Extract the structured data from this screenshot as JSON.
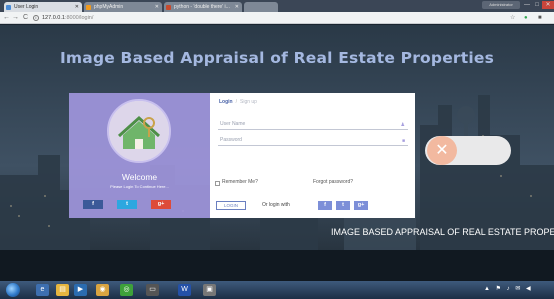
{
  "browser": {
    "tabs": [
      {
        "label": "User Login",
        "active": true
      },
      {
        "label": "phpMyAdmin",
        "active": false
      },
      {
        "label": "python - 'double there' i...",
        "active": false
      },
      {
        "label": "",
        "active": false
      }
    ],
    "url_host": "127.0.0.1",
    "url_path": ":8000/login/",
    "nav": {
      "back": "←",
      "forward": "→",
      "reload": "C"
    },
    "window": {
      "user_label": "Administrator",
      "minimize": "—",
      "maximize": "□",
      "close": "✕"
    },
    "extensions": {
      "bookmark": "☆",
      "ext1": "●",
      "ext2": "■"
    }
  },
  "page": {
    "title": "Image Based Appraisal of Real Estate Properties",
    "marquee": "IMAGE BASED APPRAISAL OF REAL ESTATE PROPERTIES"
  },
  "login_panel": {
    "welcome": "Welcome",
    "tagline": "Please Login To Continue Here...",
    "social": {
      "facebook": "f",
      "twitter": "t",
      "google": "g+"
    }
  },
  "login_form": {
    "tab_login": "Login",
    "tab_separator": "/",
    "tab_signup": "Sign up",
    "username_placeholder": "User Name",
    "password_placeholder": "Password",
    "remember_label": "Remember Me?",
    "forgot_label": "Forgot password?",
    "login_button": "LOGIN",
    "or_login_with": "Or login with",
    "social": {
      "facebook": "f",
      "twitter": "t",
      "google": "g+"
    }
  },
  "toggle": {
    "knob_glyph": "✕"
  },
  "taskbar": {
    "tray": "▲ ⚑ ♪ ✉ ◀"
  },
  "colors": {
    "accent": "#a69ede",
    "panel": "#a096dc",
    "facebook": "#3b5998",
    "twitter": "#2da7e0",
    "google": "#dd4b39",
    "title": "#a4b8e0"
  }
}
